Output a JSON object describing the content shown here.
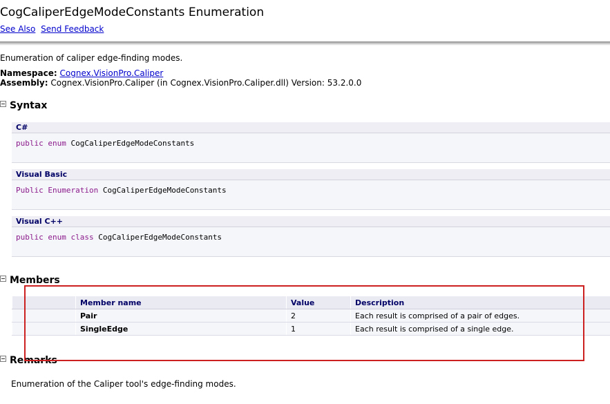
{
  "page": {
    "title": "CogCaliperEdgeModeConstants Enumeration",
    "links": {
      "see_also": "See Also",
      "send_feedback": "Send Feedback"
    },
    "summary": "Enumeration of caliper edge-finding modes.",
    "namespace_label": "Namespace:",
    "namespace_value": "Cognex.VisionPro.Caliper",
    "assembly_label": "Assembly:",
    "assembly_value": "Cognex.VisionPro.Caliper (in Cognex.VisionPro.Caliper.dll) Version: 53.2.0.0"
  },
  "syntax": {
    "heading": "Syntax",
    "blocks": [
      {
        "lang": "C#",
        "kw1": "public",
        "kw2": "enum",
        "kw3": "",
        "name": "CogCaliperEdgeModeConstants"
      },
      {
        "lang": "Visual Basic",
        "kw1": "Public",
        "kw2": "Enumeration",
        "kw3": "",
        "name": "CogCaliperEdgeModeConstants"
      },
      {
        "lang": "Visual C++",
        "kw1": "public",
        "kw2": "enum",
        "kw3": "class",
        "name": "CogCaliperEdgeModeConstants"
      }
    ]
  },
  "members": {
    "heading": "Members",
    "columns": [
      "",
      "Member name",
      "Value",
      "Description"
    ],
    "rows": [
      {
        "icon": "",
        "name": "Pair",
        "value": "2",
        "description": "Each result is comprised of a pair of edges."
      },
      {
        "icon": "",
        "name": "SingleEdge",
        "value": "1",
        "description": "Each result is comprised of a single edge."
      }
    ]
  },
  "remarks": {
    "heading": "Remarks",
    "text": "Enumeration of the Caliper tool's edge-finding modes."
  },
  "annotation": {
    "highlight_color": "#cc1f1f"
  }
}
